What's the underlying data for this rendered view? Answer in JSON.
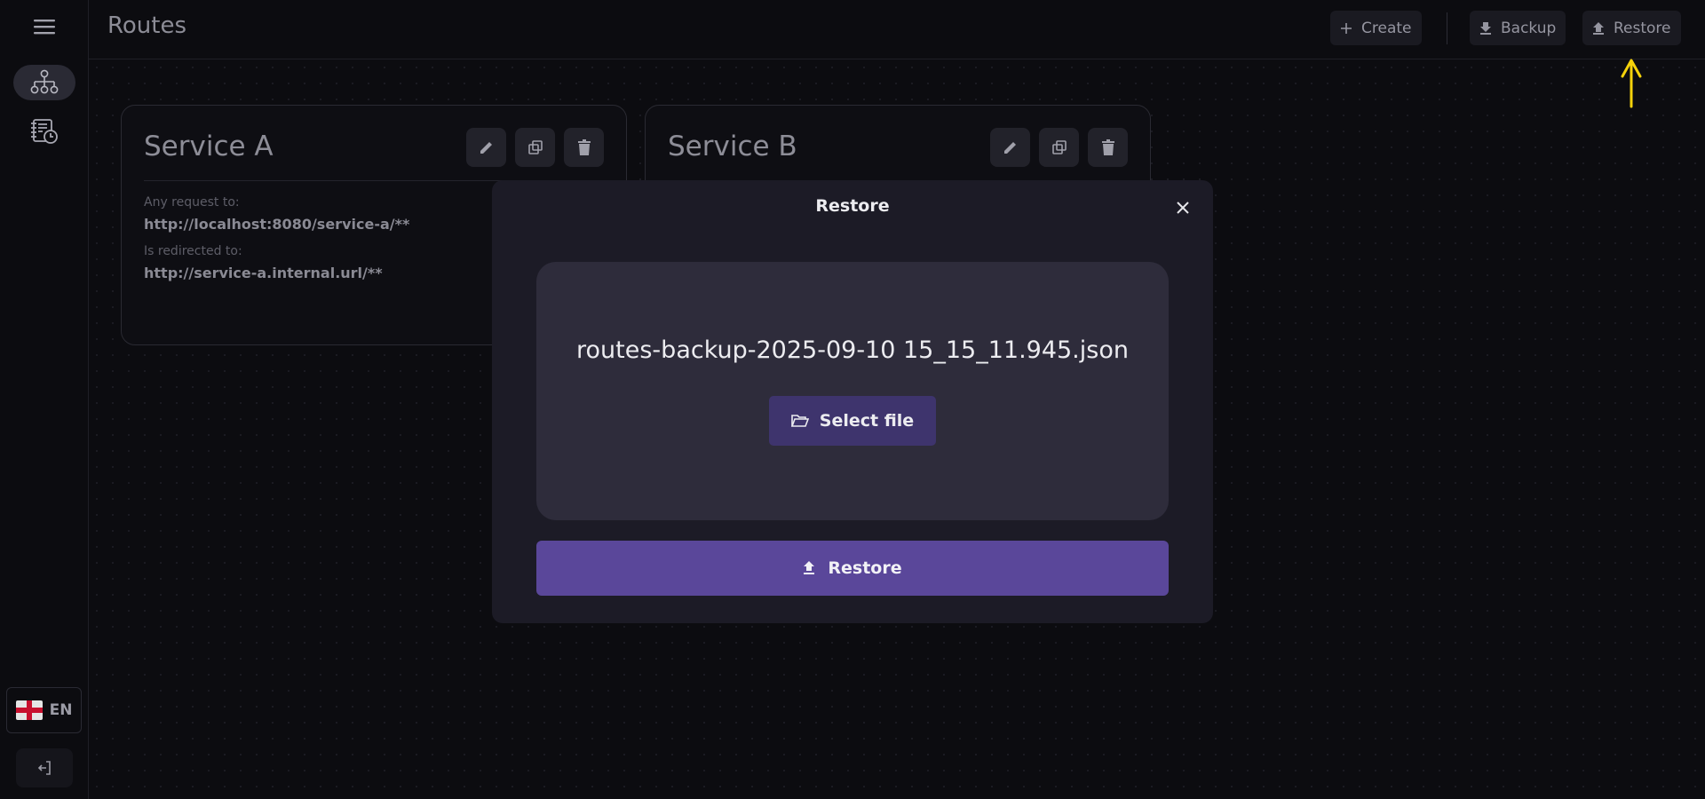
{
  "header": {
    "title": "Routes",
    "create_label": "Create",
    "backup_label": "Backup",
    "restore_label": "Restore"
  },
  "sidebar": {
    "items": [
      {
        "icon": "menu-icon"
      },
      {
        "icon": "routes-icon",
        "active": true
      },
      {
        "icon": "history-icon"
      }
    ],
    "language": "EN",
    "language_flag": "flag-england-icon",
    "logout_icon": "logout-icon"
  },
  "cards": [
    {
      "title": "Service A",
      "request_label": "Any request to:",
      "request_value": "http://localhost:8080/service-a/**",
      "redirect_label": "Is redirected to:",
      "redirect_value": "http://service-a.internal.url/**"
    },
    {
      "title": "Service B"
    }
  ],
  "modal": {
    "title": "Restore",
    "file_name": "routes-backup-2025-09-10 15_15_11.945.json",
    "select_file_label": "Select file",
    "restore_label": "Restore"
  },
  "colors": {
    "background": "#0c0c10",
    "modal_bg": "#1c1b26",
    "dropzone_bg": "#2e2c3b",
    "primary": "#5a479a",
    "select_file_bg": "#3e346d",
    "annotation": "#f5d20a"
  }
}
